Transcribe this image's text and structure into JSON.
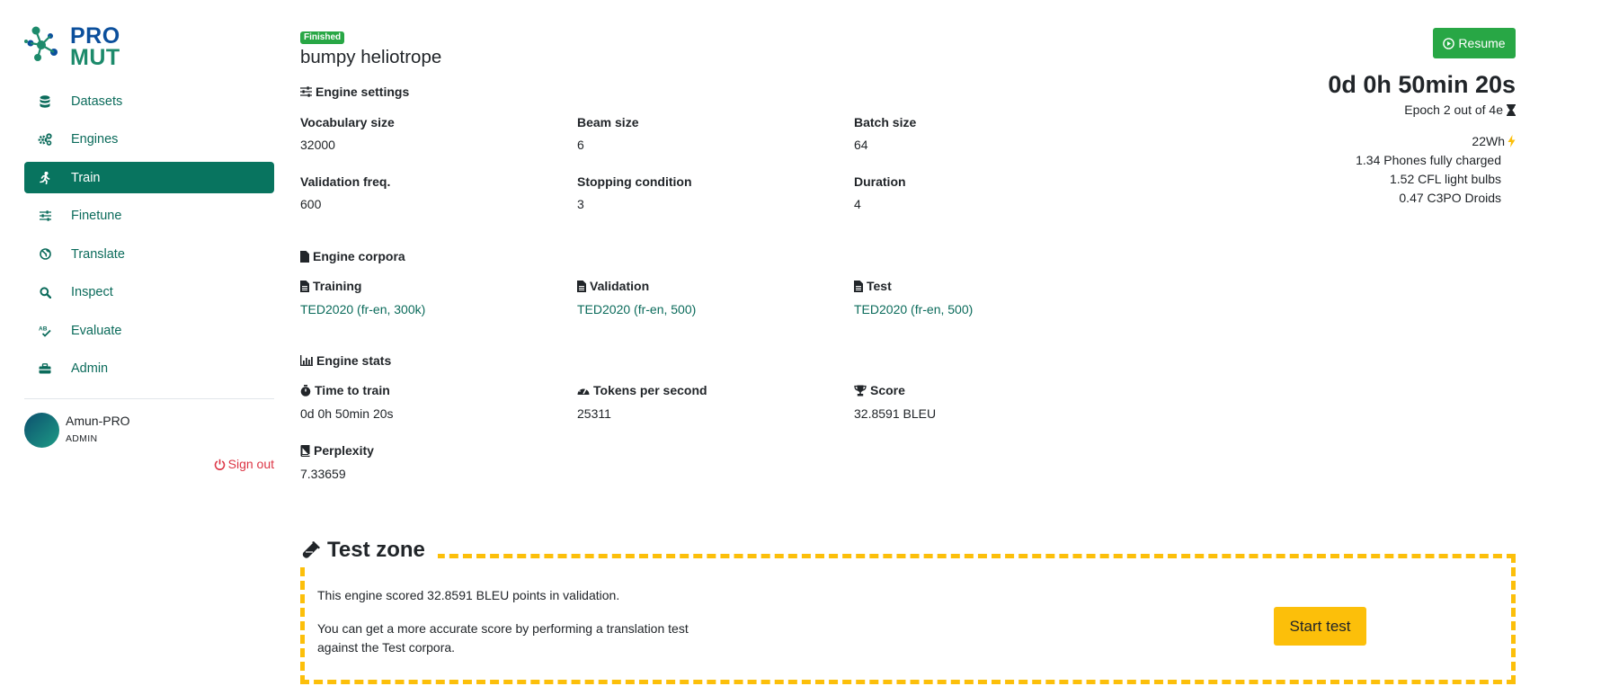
{
  "logo": {
    "line1": "PRO",
    "line2": "MUT"
  },
  "sidebar": {
    "items": [
      {
        "label": "Datasets",
        "icon": "database-icon"
      },
      {
        "label": "Engines",
        "icon": "cogs-icon"
      },
      {
        "label": "Train",
        "icon": "running-icon",
        "active": true
      },
      {
        "label": "Finetune",
        "icon": "sliders-icon"
      },
      {
        "label": "Translate",
        "icon": "globe-icon"
      },
      {
        "label": "Inspect",
        "icon": "search-icon"
      },
      {
        "label": "Evaluate",
        "icon": "spellcheck-icon"
      },
      {
        "label": "Admin",
        "icon": "toolbox-icon"
      }
    ],
    "user": {
      "name": "Amun-PRO",
      "role": "ADMIN"
    },
    "signout": "Sign out"
  },
  "engine": {
    "status": "Finished",
    "name": "bumpy heliotrope"
  },
  "settings": {
    "heading": "Engine settings",
    "vocab_label": "Vocabulary size",
    "vocab_value": "32000",
    "beam_label": "Beam size",
    "beam_value": "6",
    "batch_label": "Batch size",
    "batch_value": "64",
    "valfreq_label": "Validation freq.",
    "valfreq_value": "600",
    "stop_label": "Stopping condition",
    "stop_value": "3",
    "duration_label": "Duration",
    "duration_value": "4"
  },
  "corpora": {
    "heading": "Engine corpora",
    "training_label": "Training",
    "training_value": "TED2020 (fr-en, 300k)",
    "validation_label": "Validation",
    "validation_value": "TED2020 (fr-en, 500)",
    "test_label": "Test",
    "test_value": "TED2020 (fr-en, 500)"
  },
  "stats": {
    "heading": "Engine stats",
    "time_label": "Time to train",
    "time_value": "0d 0h 50min 20s",
    "tps_label": "Tokens per second",
    "tps_value": "25311",
    "score_label": "Score",
    "score_value": "32.8591 BLEU",
    "perp_label": "Perplexity",
    "perp_value": "7.33659"
  },
  "summary": {
    "resume_label": "Resume",
    "timer": "0d 0h 50min 20s",
    "epoch": "Epoch 2 out of 4e",
    "energy": "22Wh",
    "equivalents": [
      "1.34 Phones fully charged",
      "1.52 CFL light bulbs",
      "0.47 C3PO Droids"
    ]
  },
  "test_zone": {
    "title": "Test zone",
    "line1": "This engine scored 32.8591 BLEU points in validation.",
    "line2": "You can get a more accurate score by performing a translation test against the Test corpora.",
    "button": "Start test"
  },
  "colors": {
    "accent": "#08745f",
    "link": "#0b6b5b",
    "success": "#28a745",
    "warning": "#fcbf0a",
    "danger": "#dc3545"
  }
}
